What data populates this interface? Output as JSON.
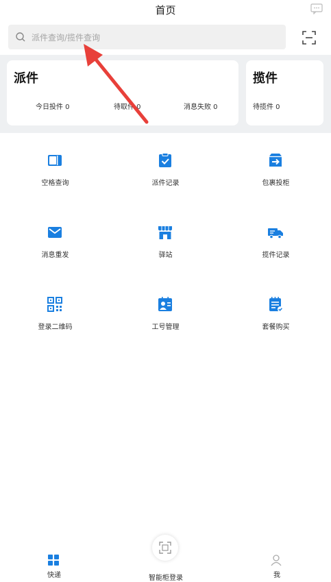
{
  "header": {
    "title": "首页",
    "message_icon": "message-icon"
  },
  "search": {
    "placeholder": "派件查询/揽件查询",
    "scan_icon": "scan-icon"
  },
  "cards": {
    "send": {
      "title": "派件",
      "stats": [
        {
          "label": "今日投件 0"
        },
        {
          "label": "待取件 0"
        },
        {
          "label": "消息失败  0"
        }
      ]
    },
    "collect": {
      "title": "揽件",
      "stats": [
        {
          "label": "待揽件  0"
        }
      ]
    }
  },
  "grid": [
    {
      "label": "空格查询",
      "icon": "cabinet-icon"
    },
    {
      "label": "派件记录",
      "icon": "clipboard-check-icon"
    },
    {
      "label": "包裹投柜",
      "icon": "box-arrow-icon"
    },
    {
      "label": "消息重发",
      "icon": "mail-icon"
    },
    {
      "label": "驿站",
      "icon": "store-icon"
    },
    {
      "label": "揽件记录",
      "icon": "truck-icon"
    },
    {
      "label": "登录二维码",
      "icon": "qr-code-icon"
    },
    {
      "label": "工号管理",
      "icon": "id-badge-icon"
    },
    {
      "label": "套餐购买",
      "icon": "notepad-check-icon"
    }
  ],
  "tabbar": {
    "tabs": [
      {
        "label": "快递",
        "icon": "grid-icon"
      },
      {
        "label": "智能柜登录",
        "icon": "scan-icon"
      },
      {
        "label": "我",
        "icon": "user-icon"
      }
    ]
  },
  "colors": {
    "accent": "#1a7fe0",
    "annotation_arrow": "#e8403a",
    "card_bg": "#eef0f2"
  }
}
